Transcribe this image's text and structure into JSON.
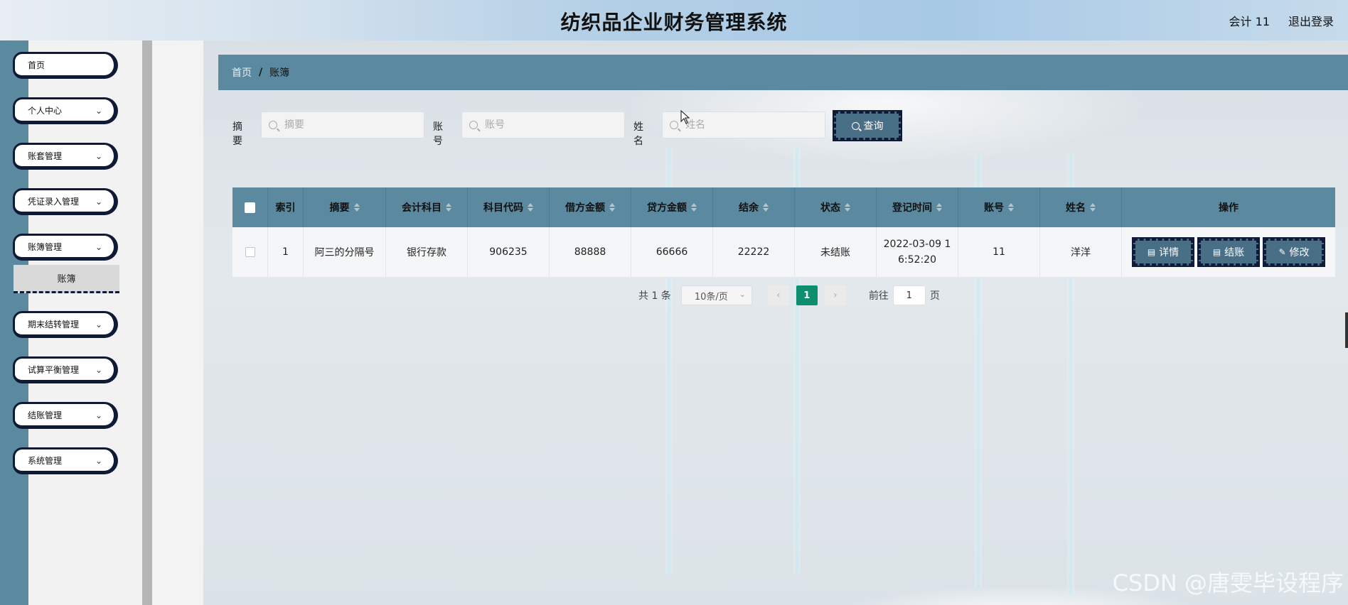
{
  "header": {
    "title": "纺织品企业财务管理系统",
    "user": "会计 11",
    "logout": "退出登录"
  },
  "sidebar": {
    "items": [
      {
        "label": "首页",
        "has_children": false
      },
      {
        "label": "个人中心",
        "has_children": true
      },
      {
        "label": "账套管理",
        "has_children": true
      },
      {
        "label": "凭证录入管理",
        "has_children": true
      },
      {
        "label": "账簿管理",
        "has_children": true
      },
      {
        "label": "期末结转管理",
        "has_children": true
      },
      {
        "label": "试算平衡管理",
        "has_children": true
      },
      {
        "label": "结账管理",
        "has_children": true
      },
      {
        "label": "系统管理",
        "has_children": true
      }
    ],
    "active_submenu": "账簿"
  },
  "breadcrumb": {
    "home": "首页",
    "separator": "/",
    "current": "账簿"
  },
  "search": {
    "summary_label": "摘要",
    "summary_placeholder": "摘要",
    "account_label": "账号",
    "account_placeholder": "账号",
    "name_label": "姓名",
    "name_placeholder": "姓名",
    "query_button": "查询"
  },
  "table": {
    "columns": [
      "索引",
      "摘要",
      "会计科目",
      "科目代码",
      "借方金额",
      "贷方金额",
      "结余",
      "状态",
      "登记时间",
      "账号",
      "姓名",
      "操作"
    ],
    "rows": [
      {
        "index": "1",
        "summary": "阿三的分隔号",
        "subject": "银行存款",
        "subject_code": "906235",
        "debit": "88888",
        "credit": "66666",
        "balance": "22222",
        "status": "未结账",
        "time_line1": "2022-03-09 1",
        "time_line2": "6:52:20",
        "account": "11",
        "name": "洋洋"
      }
    ],
    "actions": {
      "detail": "详情",
      "settle": "结账",
      "edit": "修改"
    }
  },
  "pagination": {
    "total": "共 1 条",
    "page_size": "10条/页",
    "current_page": "1",
    "goto_label": "前往",
    "goto_value": "1",
    "page_suffix": "页"
  },
  "watermark": "CSDN @唐雯毕设程序",
  "colors": {
    "sidebar_accent": "#5b899f",
    "button": "#486f86",
    "button_border": "#0e1a36",
    "page_active": "#0d8f6f"
  }
}
